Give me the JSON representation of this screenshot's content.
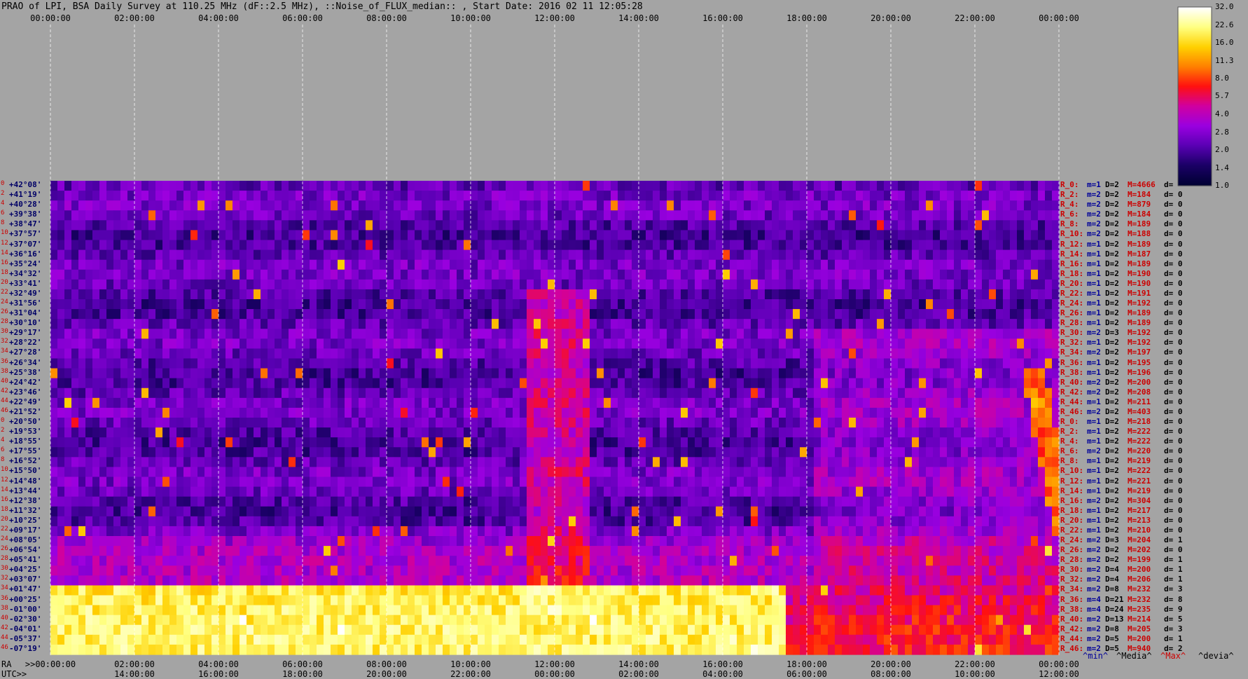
{
  "title": "PRAO of LPI, BSA Daily Survey at 110.25 MHz (dF::2.5 MHz), ::Noise_of_FLUX_median:: , Start Date: 2016 02 11 12:05:28",
  "chart_data": {
    "type": "heatmap",
    "title": "PRAO of LPI, BSA Daily Survey at 110.25 MHz (dF::2.5 MHz), ::Noise_of_FLUX_median:: , Start Date: 2016 02 11 12:05:28",
    "top_axis_ticks": [
      "00:00:00",
      "02:00:00",
      "04:00:00",
      "06:00:00",
      "08:00:00",
      "10:00:00",
      "12:00:00",
      "14:00:00",
      "16:00:00",
      "18:00:00",
      "20:00:00",
      "22:00:00",
      "00:00:00"
    ],
    "bottom_ra_ticks": [
      ">>00:00:00",
      "02:00:00",
      "04:00:00",
      "06:00:00",
      "08:00:00",
      "10:00:00",
      "12:00:00",
      "14:00:00",
      "16:00:00",
      "18:00:00",
      "20:00:00",
      "22:00:00",
      "00:00:00"
    ],
    "bottom_utc_ticks": [
      "14:00:00",
      "16:00:00",
      "18:00:00",
      "20:00:00",
      "22:00:00",
      "00:00:00",
      "02:00:00",
      "04:00:00",
      "06:00:00",
      "08:00:00",
      "10:00:00",
      "12:00:00"
    ],
    "ra_label": "RA",
    "utc_label": "UTC>>",
    "declinations": [
      "+42°08'",
      "+41°19'",
      "+40°28'",
      "+39°38'",
      "+38°47'",
      "+37°57'",
      "+37°07'",
      "+36°16'",
      "+35°24'",
      "+34°32'",
      "+33°41'",
      "+32°49'",
      "+31°56'",
      "+31°04'",
      "+30°10'",
      "+29°17'",
      "+28°22'",
      "+27°28'",
      "+26°34'",
      "+25°38'",
      "+24°42'",
      "+23°46'",
      "+22°49'",
      "+21°52'",
      "+20°50'",
      "+19°53'",
      "+18°55'",
      "+17°55'",
      "+16°52'",
      "+15°50'",
      "+14°48'",
      "+13°44'",
      "+12°38'",
      "+11°32'",
      "+10°25'",
      "+09°17'",
      "+08°05'",
      "+06°54'",
      "+05°41'",
      "+04°25'",
      "+03°07'",
      "+01°47'",
      "+00°25'",
      "-01°00'",
      "-02°30'",
      "-04°01'",
      "-05°37'",
      "-07°19'"
    ],
    "beam_numbers": [
      "0",
      "2",
      "4",
      "6",
      "8",
      "10",
      "12",
      "14",
      "16",
      "18",
      "20",
      "22",
      "24",
      "26",
      "28",
      "30",
      "32",
      "34",
      "36",
      "38",
      "40",
      "42",
      "44",
      "46",
      "0",
      "2",
      "4",
      "6",
      "8",
      "10",
      "12",
      "14",
      "16",
      "18",
      "20",
      "22",
      "24",
      "26",
      "28",
      "30",
      "32",
      "34",
      "36",
      "38",
      "40",
      "42",
      "44",
      "46"
    ],
    "stats_header": [
      "^min^",
      "^Media^",
      "^Max^",
      "^devia^"
    ],
    "stats_rows": [
      {
        "r": "R_0:",
        "m": "m=1",
        "D": "D=2",
        "M": "M=4666",
        "d": "d="
      },
      {
        "r": "R_2:",
        "m": "m=2",
        "D": "D=2",
        "M": "M=184",
        "d": "d= 0"
      },
      {
        "r": "R_4:",
        "m": "m=2",
        "D": "D=2",
        "M": "M=879",
        "d": "d= 0"
      },
      {
        "r": "R_6:",
        "m": "m=2",
        "D": "D=2",
        "M": "M=184",
        "d": "d= 0"
      },
      {
        "r": "R_8:",
        "m": "m=2",
        "D": "D=2",
        "M": "M=189",
        "d": "d= 0"
      },
      {
        "r": "R_10:",
        "m": "m=2",
        "D": "D=2",
        "M": "M=188",
        "d": "d= 0"
      },
      {
        "r": "R_12:",
        "m": "m=1",
        "D": "D=2",
        "M": "M=189",
        "d": "d= 0"
      },
      {
        "r": "R_14:",
        "m": "m=1",
        "D": "D=2",
        "M": "M=187",
        "d": "d= 0"
      },
      {
        "r": "R_16:",
        "m": "m=1",
        "D": "D=2",
        "M": "M=189",
        "d": "d= 0"
      },
      {
        "r": "R_18:",
        "m": "m=1",
        "D": "D=2",
        "M": "M=190",
        "d": "d= 0"
      },
      {
        "r": "R_20:",
        "m": "m=1",
        "D": "D=2",
        "M": "M=190",
        "d": "d= 0"
      },
      {
        "r": "R_22:",
        "m": "m=1",
        "D": "D=2",
        "M": "M=191",
        "d": "d= 0"
      },
      {
        "r": "R_24:",
        "m": "m=1",
        "D": "D=2",
        "M": "M=192",
        "d": "d= 0"
      },
      {
        "r": "R_26:",
        "m": "m=1",
        "D": "D=2",
        "M": "M=189",
        "d": "d= 0"
      },
      {
        "r": "R_28:",
        "m": "m=1",
        "D": "D=2",
        "M": "M=189",
        "d": "d= 0"
      },
      {
        "r": "R_30:",
        "m": "m=2",
        "D": "D=3",
        "M": "M=192",
        "d": "d= 0"
      },
      {
        "r": "R_32:",
        "m": "m=1",
        "D": "D=2",
        "M": "M=192",
        "d": "d= 0"
      },
      {
        "r": "R_34:",
        "m": "m=2",
        "D": "D=2",
        "M": "M=197",
        "d": "d= 0"
      },
      {
        "r": "R_36:",
        "m": "m=1",
        "D": "D=2",
        "M": "M=195",
        "d": "d= 0"
      },
      {
        "r": "R_38:",
        "m": "m=1",
        "D": "D=2",
        "M": "M=196",
        "d": "d= 0"
      },
      {
        "r": "R_40:",
        "m": "m=2",
        "D": "D=2",
        "M": "M=200",
        "d": "d= 0"
      },
      {
        "r": "R_42:",
        "m": "m=2",
        "D": "D=2",
        "M": "M=208",
        "d": "d= 0"
      },
      {
        "r": "R_44:",
        "m": "m=1",
        "D": "D=2",
        "M": "M=211",
        "d": "d= 0"
      },
      {
        "r": "R_46:",
        "m": "m=2",
        "D": "D=2",
        "M": "M=403",
        "d": "d= 0"
      },
      {
        "r": "R_0:",
        "m": "m=1",
        "D": "D=2",
        "M": "M=218",
        "d": "d= 0"
      },
      {
        "r": "R_2:",
        "m": "m=1",
        "D": "D=2",
        "M": "M=222",
        "d": "d= 0"
      },
      {
        "r": "R_4:",
        "m": "m=1",
        "D": "D=2",
        "M": "M=222",
        "d": "d= 0"
      },
      {
        "r": "R_6:",
        "m": "m=2",
        "D": "D=2",
        "M": "M=220",
        "d": "d= 0"
      },
      {
        "r": "R_8:",
        "m": "m=1",
        "D": "D=2",
        "M": "M=219",
        "d": "d= 0"
      },
      {
        "r": "R_10:",
        "m": "m=1",
        "D": "D=2",
        "M": "M=222",
        "d": "d= 0"
      },
      {
        "r": "R_12:",
        "m": "m=1",
        "D": "D=2",
        "M": "M=221",
        "d": "d= 0"
      },
      {
        "r": "R_14:",
        "m": "m=1",
        "D": "D=2",
        "M": "M=219",
        "d": "d= 0"
      },
      {
        "r": "R_16:",
        "m": "m=2",
        "D": "D=2",
        "M": "M=304",
        "d": "d= 0"
      },
      {
        "r": "R_18:",
        "m": "m=1",
        "D": "D=2",
        "M": "M=217",
        "d": "d= 0"
      },
      {
        "r": "R_20:",
        "m": "m=1",
        "D": "D=2",
        "M": "M=213",
        "d": "d= 0"
      },
      {
        "r": "R_22:",
        "m": "m=1",
        "D": "D=2",
        "M": "M=210",
        "d": "d= 0"
      },
      {
        "r": "R_24:",
        "m": "m=2",
        "D": "D=3",
        "M": "M=204",
        "d": "d= 1"
      },
      {
        "r": "R_26:",
        "m": "m=2",
        "D": "D=2",
        "M": "M=202",
        "d": "d= 0"
      },
      {
        "r": "R_28:",
        "m": "m=2",
        "D": "D=2",
        "M": "M=199",
        "d": "d= 1"
      },
      {
        "r": "R_30:",
        "m": "m=2",
        "D": "D=4",
        "M": "M=200",
        "d": "d= 1"
      },
      {
        "r": "R_32:",
        "m": "m=2",
        "D": "D=4",
        "M": "M=206",
        "d": "d= 1"
      },
      {
        "r": "R_34:",
        "m": "m=2",
        "D": "D=8",
        "M": "M=232",
        "d": "d= 3"
      },
      {
        "r": "R_36:",
        "m": "m=4",
        "D": "D=21",
        "M": "M=232",
        "d": "d= 8"
      },
      {
        "r": "R_38:",
        "m": "m=4",
        "D": "D=24",
        "M": "M=235",
        "d": "d= 9"
      },
      {
        "r": "R_40:",
        "m": "m=2",
        "D": "D=13",
        "M": "M=214",
        "d": "d= 5"
      },
      {
        "r": "R_42:",
        "m": "m=2",
        "D": "D=8",
        "M": "M=205",
        "d": "d= 3"
      },
      {
        "r": "R_44:",
        "m": "m=2",
        "D": "D=5",
        "M": "M=200",
        "d": "d= 1"
      },
      {
        "r": "R_46:",
        "m": "m=2",
        "D": "D=5",
        "M": "M=940",
        "d": "d= 2"
      }
    ],
    "colorbar_ticks": [
      "32.0",
      "22.6",
      "16.0",
      "11.3",
      "8.0",
      "5.7",
      "4.0",
      "2.8",
      "2.0",
      "1.4",
      "1.0"
    ],
    "colorbar_values": [
      32.0,
      22.6,
      16.0,
      11.3,
      8.0,
      5.7,
      4.0,
      2.8,
      2.0,
      1.4,
      1.0
    ],
    "colorbar_scale": "log",
    "colormap": [
      "#000033",
      "#1a0066",
      "#5a00b4",
      "#9a00e0",
      "#d000a0",
      "#ff1010",
      "#ff8000",
      "#ffd000",
      "#ffff80",
      "#ffffff"
    ],
    "grid": true
  },
  "colors": {
    "background": "#a4a4a4",
    "decl_label": "#000066",
    "beam_label": "#cc0000",
    "stats_r": "#cc0000",
    "stats_m": "#000099",
    "stats_D": "#000000",
    "stats_M": "#cc0000",
    "stats_d": "#000000"
  }
}
